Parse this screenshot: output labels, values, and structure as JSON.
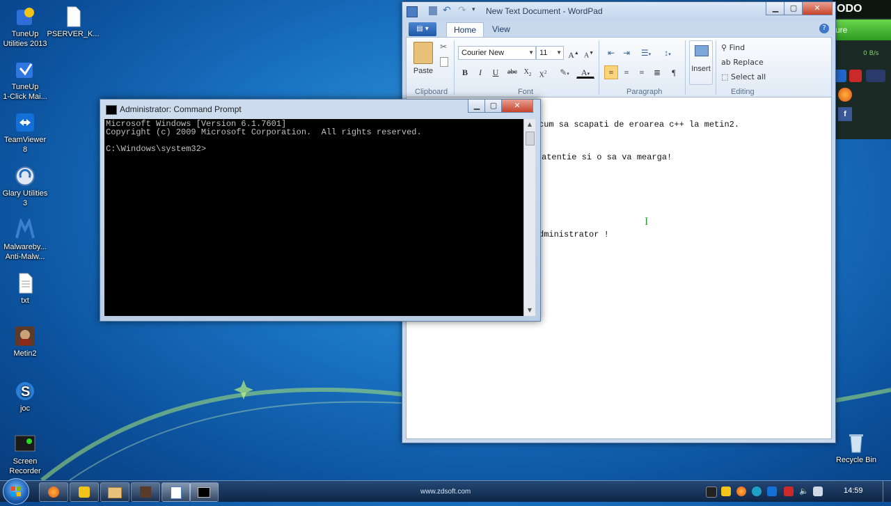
{
  "desktop": {
    "icons": [
      {
        "label": "TuneUp\nUtilities 2013",
        "icon": "tuneup-icon"
      },
      {
        "label": "PSERVER_K...",
        "icon": "file-icon"
      },
      {
        "label": "TuneUp\n1-Click Mai...",
        "icon": "tuneup-1click-icon"
      },
      {
        "label": "TeamViewer\n8",
        "icon": "teamviewer-icon"
      },
      {
        "label": "Glary Utilities\n3",
        "icon": "glary-icon"
      },
      {
        "label": "Malwareby...\nAnti-Malw...",
        "icon": "malwarebytes-icon"
      },
      {
        "label": "txt",
        "icon": "text-file-icon"
      },
      {
        "label": "Metin2",
        "icon": "metin2-icon"
      },
      {
        "label": "joc",
        "icon": "joc-icon"
      },
      {
        "label": "Screen\nRecorder",
        "icon": "screen-recorder-icon"
      },
      {
        "label": "Recycle Bin",
        "icon": "recycle-bin-icon"
      }
    ],
    "watermark": "www.zdsoft.com"
  },
  "wordpad": {
    "title": "New Text Document - WordPad",
    "tabs": [
      "Home",
      "View"
    ],
    "groups": {
      "clipboard": "Clipboard",
      "font": "Font",
      "paragraph": "Paragraph",
      "editing": "Editing"
    },
    "paste_label": "Paste",
    "insert_label": "Insert",
    "font_name": "Courier New",
    "font_size": "11",
    "find_label": "Find",
    "replace_label": "Replace",
    "select_all_label": "Select all",
    "doc_lines": [
      "cum sa scapati de eroarea c++ la metin2.",
      "atentie si o sa va mearga!",
      "dministrator !"
    ]
  },
  "cmd": {
    "title": "Administrator: Command Prompt",
    "lines": [
      "Microsoft Windows [Version 6.1.7601]",
      "Copyright (c) 2009 Microsoft Corporation.  All rights reserved.",
      "",
      "C:\\Windows\\system32>"
    ]
  },
  "gadget": {
    "brand": "ODO",
    "status": "ure",
    "speed": "0 B/s"
  },
  "taskbar": {
    "clock": "14:59"
  }
}
